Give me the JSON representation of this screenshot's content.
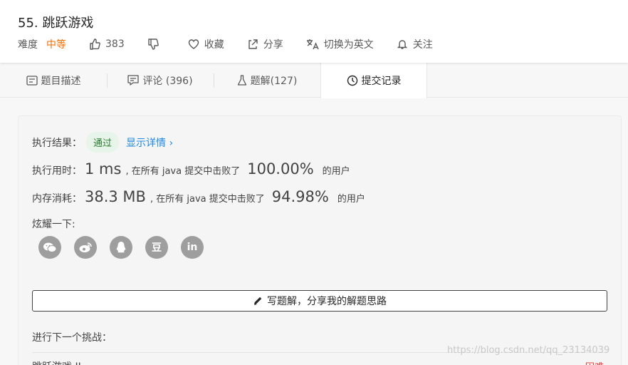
{
  "problem": {
    "title": "55. 跳跃游戏",
    "difficulty_label": "难度",
    "difficulty": "中等",
    "likes": "383",
    "favorite_label": "收藏",
    "share_label": "分享",
    "translate_label": "切换为英文",
    "follow_label": "关注"
  },
  "tabs": [
    {
      "label": "题目描述",
      "icon": "description-icon"
    },
    {
      "label": "评论 (396)",
      "icon": "comment-icon"
    },
    {
      "label": "题解(127)",
      "icon": "flask-icon"
    },
    {
      "label": "提交记录",
      "icon": "clock-icon"
    }
  ],
  "active_tab": "提交记录",
  "result": {
    "exec_result_label": "执行结果：",
    "status": "通过",
    "details_link": "显示详情 ›",
    "time_label": "执行用时：",
    "time_value": "1 ms",
    "time_mid": ", 在所有 java 提交中击败了",
    "time_pct": "100.00%",
    "time_suffix": "的用户",
    "memory_label": "内存消耗：",
    "memory_value": "38.3 MB",
    "memory_mid": ", 在所有 java 提交中击败了",
    "memory_pct": "94.98%",
    "memory_suffix": "的用户",
    "share_prompt": "炫耀一下:",
    "share_icons": [
      "wechat-icon",
      "weibo-icon",
      "qq-icon",
      "douban-icon",
      "linkedin-icon"
    ],
    "share_glyphs": [
      "",
      "",
      "",
      "豆",
      "in"
    ],
    "solution_button": "写题解，分享我的解题思路",
    "next_challenge_label": "进行下一个挑战：",
    "next_item": "跳跃游戏 II",
    "next_item_badge": "困难"
  },
  "watermark": "https://blog.csdn.net/qq_23134039",
  "colors": {
    "difficulty_medium": "#ef6c00",
    "link": "#1e88e5",
    "success": "#2e7d32",
    "success_bg": "#e6f4ea"
  }
}
